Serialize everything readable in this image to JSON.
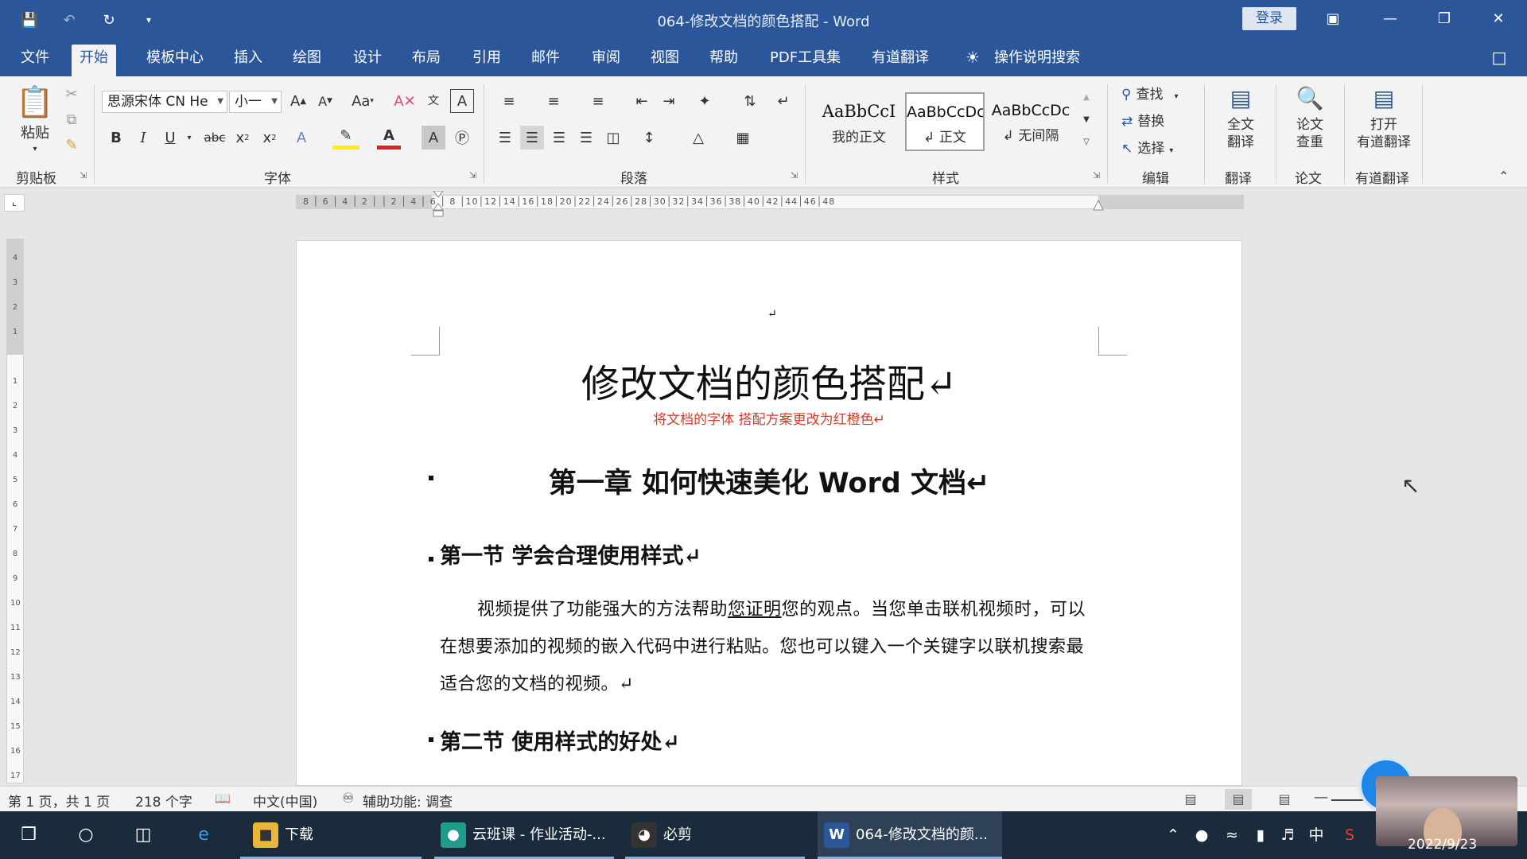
{
  "window": {
    "title": "064-修改文档的颜色搭配  -  Word",
    "login_label": "登录"
  },
  "qat": {
    "save_icon": "save-icon",
    "undo_icon": "undo-icon",
    "redo_icon": "redo-icon",
    "customize_icon": "customize-qat-icon"
  },
  "tabs": [
    {
      "label": "文件"
    },
    {
      "label": "开始"
    },
    {
      "label": "模板中心"
    },
    {
      "label": "插入"
    },
    {
      "label": "绘图"
    },
    {
      "label": "设计"
    },
    {
      "label": "布局"
    },
    {
      "label": "引用"
    },
    {
      "label": "邮件"
    },
    {
      "label": "审阅"
    },
    {
      "label": "视图"
    },
    {
      "label": "帮助"
    },
    {
      "label": "PDF工具集"
    },
    {
      "label": "有道翻译"
    }
  ],
  "tell_me": "操作说明搜索",
  "ribbon": {
    "clipboard": {
      "label": "剪贴板",
      "paste": "粘贴"
    },
    "font": {
      "label": "字体",
      "font_name": "思源宋体 CN He",
      "font_size": "小一"
    },
    "paragraph": {
      "label": "段落"
    },
    "styles": {
      "label": "样式",
      "items": [
        {
          "sample": "AaBbCcI",
          "name": "我的正文"
        },
        {
          "sample": "AaBbCcDc",
          "name": "↲ 正文"
        },
        {
          "sample": "AaBbCcDc",
          "name": "↲ 无间隔"
        }
      ]
    },
    "editing": {
      "label": "编辑",
      "find": "查找",
      "replace": "替换",
      "select": "选择"
    },
    "translate": {
      "label": "翻译",
      "button": "全文\n翻译",
      "line1": "全文",
      "line2": "翻译"
    },
    "paper": {
      "label": "论文",
      "line1": "论文",
      "line2": "查重"
    },
    "youdao": {
      "label": "有道翻译",
      "line1": "打开",
      "line2": "有道翻译"
    }
  },
  "ruler": {
    "h_ticks": "8 │ 6 │ 4 │ 2 │   │ 2 │ 4 │ 6 │ 8 │10│12│14│16│18│20│22│24│26│28│30│32│34│36│38│40│42│44│46│48",
    "v_ticks": [
      "4",
      "3",
      "2",
      "1",
      "",
      "1",
      "2",
      "3",
      "4",
      "5",
      "6",
      "7",
      "8",
      "9",
      "10",
      "11",
      "12",
      "13",
      "14",
      "15",
      "16",
      "17"
    ]
  },
  "document": {
    "title": "修改文档的颜色搭配↵",
    "subtitle": "将文档的字体  搭配方案更改为红橙色↵",
    "chapter": "第一章 如何快速美化 Word 文档↵",
    "section1": "第一节 学会合理使用样式↵",
    "body_before": "视频提供了功能强大的方法帮助",
    "body_underlined": "您证明",
    "body_after": "您的观点。当您单击联机视频时，可以在想要添加的视频的嵌入代码中进行粘贴。您也可以键入一个关键字以联机搜索最适合您的文档的视频。↵",
    "section2": "第二节 使用样式的好处↵",
    "top_mark": "↵"
  },
  "status": {
    "page": "第 1 页，共 1 页",
    "words": "218 个字",
    "language": "中文(中国)",
    "accessibility": "辅助功能: 调查"
  },
  "taskbar": {
    "apps": [
      {
        "label": "下载"
      },
      {
        "label": "云班课 - 作业活动-..."
      },
      {
        "label": "必剪"
      },
      {
        "label": "064-修改文档的颜..."
      }
    ],
    "ime": "中",
    "date": "2022/9/23"
  },
  "badge": "0",
  "colors": {
    "brand": "#2b579a",
    "subtitle_red": "#d53b2b"
  }
}
